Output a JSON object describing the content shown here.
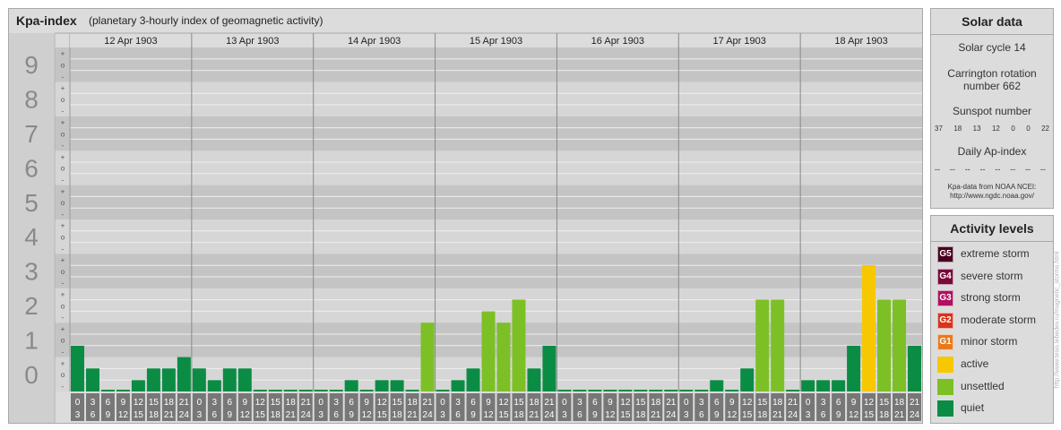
{
  "title": "Kpa-index",
  "subtitle": "(planetary 3-hourly index of geomagnetic activity)",
  "chart_data": {
    "type": "bar",
    "ylim": [
      0,
      9
    ],
    "y_ticks": [
      "0",
      "1",
      "2",
      "3",
      "4",
      "5",
      "6",
      "7",
      "8",
      "9"
    ],
    "minor_ticks": [
      "-",
      "o",
      "+"
    ],
    "days": [
      "12 Apr 1903",
      "13 Apr 1903",
      "14 Apr 1903",
      "15 Apr 1903",
      "16 Apr 1903",
      "17 Apr 1903",
      "18 Apr 1903"
    ],
    "interval_start": [
      "0",
      "3",
      "6",
      "9",
      "12",
      "15",
      "18",
      "21"
    ],
    "interval_end": [
      "3",
      "6",
      "9",
      "12",
      "15",
      "18",
      "21",
      "24"
    ],
    "values": [
      [
        1.33,
        0.67,
        0,
        0,
        0.33,
        0.67,
        0.67,
        1.0
      ],
      [
        0.67,
        0.33,
        0.67,
        0.67,
        0,
        0,
        0,
        0
      ],
      [
        0,
        0,
        0.33,
        0,
        0.33,
        0.33,
        0,
        2.0
      ],
      [
        0,
        0.33,
        0.67,
        2.33,
        2.0,
        2.67,
        0.67,
        1.33
      ],
      [
        0,
        0,
        0,
        0,
        0,
        0,
        0,
        0
      ],
      [
        0,
        0,
        0.33,
        0,
        0.67,
        2.67,
        2.67,
        0
      ],
      [
        0.33,
        0.33,
        0.33,
        1.33,
        3.67,
        2.67,
        2.67,
        1.33
      ]
    ]
  },
  "solar": {
    "title": "Solar data",
    "cycle": "Solar cycle 14",
    "carrington_1": "Carrington rotation",
    "carrington_2": "number 662",
    "sunspot_title": "Sunspot number",
    "sunspots": [
      "37",
      "18",
      "13",
      "12",
      "0",
      "0",
      "22"
    ],
    "ap_title": "Daily Ap-index",
    "ap_values": [
      "--",
      "--",
      "--",
      "--",
      "--",
      "--",
      "--",
      "--"
    ],
    "source_1": "Kpa-data from NOAA NCEI:",
    "source_2": "http://www.ngdc.noaa.gov/"
  },
  "activity": {
    "title": "Activity levels",
    "levels": [
      {
        "badge": "G5",
        "label": "extreme storm",
        "color": "#4a0020"
      },
      {
        "badge": "G4",
        "label": "severe storm",
        "color": "#7a0a3c"
      },
      {
        "badge": "G3",
        "label": "strong storm",
        "color": "#b01060"
      },
      {
        "badge": "G2",
        "label": "moderate storm",
        "color": "#d8341c"
      },
      {
        "badge": "G1",
        "label": "minor storm",
        "color": "#e87a1e"
      },
      {
        "badge": "",
        "label": "active",
        "color": "#f7c800"
      },
      {
        "badge": "",
        "label": "unsettled",
        "color": "#7cc026"
      },
      {
        "badge": "",
        "label": "quiet",
        "color": "#0b8c44"
      }
    ]
  },
  "watermark": "http://www.tesis.lebedev.ru/magnetic_storms.html"
}
